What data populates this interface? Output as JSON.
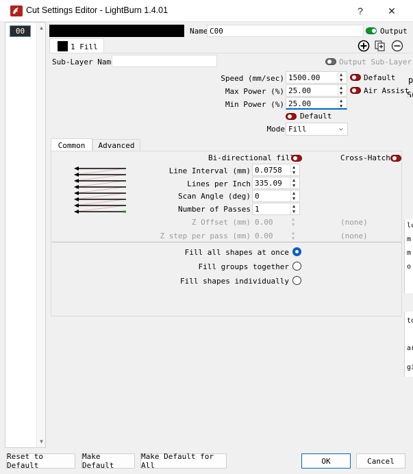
{
  "window": {
    "title": "Cut Settings Editor - LightBurn 1.4.01",
    "help": "?",
    "close": "✕"
  },
  "layers": [
    {
      "label": "00"
    }
  ],
  "header": {
    "name_label": "Name",
    "name_value": "C00",
    "output_label": "Output",
    "tab_label": "1 Fill",
    "sublayer_label": "Sub-Layer Name",
    "sublayer_value": "",
    "output_sublayer_label": "Output Sub-Layer"
  },
  "settings": {
    "speed_label": "Speed (mm/sec)",
    "speed": "1500.00",
    "default_label": "Default",
    "max_power_label": "Max Power (%)",
    "max_power": "25.00",
    "air_assist_label": "Air Assist",
    "min_power_label": "Min Power (%)",
    "min_power": "25.00",
    "default2_label": "Default",
    "mode_label": "Mode",
    "mode_value": "Fill"
  },
  "inner_tabs": [
    "Common",
    "Advanced"
  ],
  "common": {
    "bidirectional_label": "Bi-directional fill",
    "crosshatch_label": "Cross-Hatch",
    "line_interval_label": "Line Interval (mm)",
    "line_interval": "0.0758",
    "lpi_label": "Lines per Inch",
    "lpi": "335.09",
    "scan_angle_label": "Scan Angle (deg)",
    "scan_angle": "0",
    "passes_label": "Number of Passes",
    "passes": "1",
    "z_offset_label": "Z Offset (mm)",
    "z_offset": "0.00",
    "z_offset_note": "(none)",
    "z_step_label": "Z step per pass (mm)",
    "z_step": "0.00",
    "z_step_note": "(none)",
    "fill_options": [
      {
        "label": "Fill all shapes at once",
        "selected": true
      },
      {
        "label": "Fill groups together",
        "selected": false
      },
      {
        "label": "Fill shapes individually",
        "selected": false
      }
    ]
  },
  "footer": {
    "reset": "Reset to Default",
    "make_default": "Make Default",
    "make_default_all": "Make Default for All",
    "ok": "OK",
    "cancel": "Cancel"
  },
  "colors": {
    "accent": "#0067c0",
    "toggle_on": "#0a9a0a",
    "toggle_off": "#9c1414"
  },
  "right_edge": {
    "frag1": "p",
    "frag2": "50",
    "frag3": "lc",
    "frag4": "m",
    "frag5": "m",
    "frag6": "o",
    "frag7": "to",
    "frag8": "ar",
    "frag9": "gi"
  }
}
